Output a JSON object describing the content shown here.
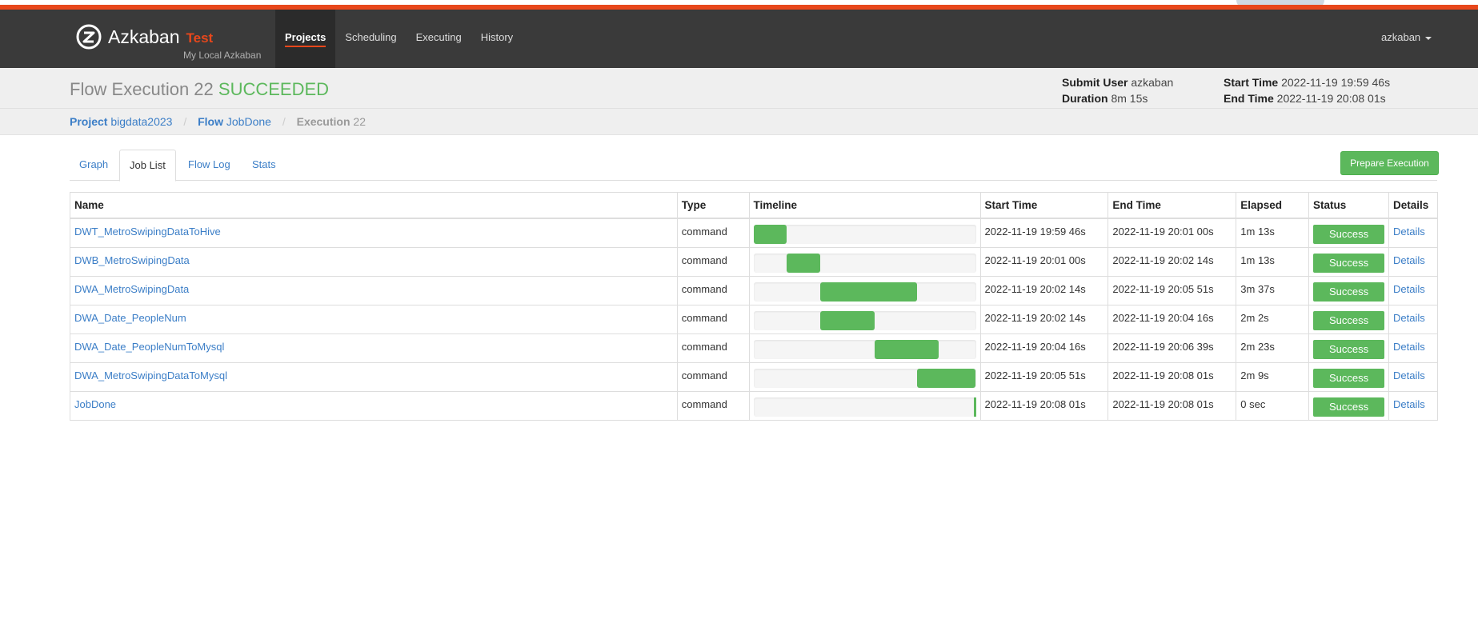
{
  "app": {
    "name": "Azkaban",
    "env": "Test",
    "subtitle": "My Local Azkaban"
  },
  "nav": {
    "items": [
      "Projects",
      "Scheduling",
      "Executing",
      "History"
    ],
    "active": "Projects",
    "user": "azkaban"
  },
  "header": {
    "title_prefix": "Flow Execution 22",
    "status": "SUCCEEDED",
    "submit_user_label": "Submit User",
    "submit_user": "azkaban",
    "duration_label": "Duration",
    "duration": "8m 15s",
    "start_time_label": "Start Time",
    "start_time": "2022-11-19 19:59 46s",
    "end_time_label": "End Time",
    "end_time": "2022-11-19 20:08 01s"
  },
  "breadcrumb": {
    "project_label": "Project",
    "project": "bigdata2023",
    "flow_label": "Flow",
    "flow": "JobDone",
    "execution_label": "Execution",
    "execution": "22"
  },
  "tabs": [
    "Graph",
    "Job List",
    "Flow Log",
    "Stats"
  ],
  "active_tab": "Job List",
  "prepare_button": "Prepare Execution",
  "table": {
    "headers": [
      "Name",
      "Type",
      "Timeline",
      "Start Time",
      "End Time",
      "Elapsed",
      "Status",
      "Details"
    ],
    "rows": [
      {
        "name": "DWT_MetroSwipingDataToHive",
        "type": "command",
        "start": "2022-11-19 19:59 46s",
        "end": "2022-11-19 20:01 00s",
        "elapsed": "1m 13s",
        "status": "Success",
        "details": "Details",
        "tl_start": 0.0,
        "tl_end": 0.149
      },
      {
        "name": "DWB_MetroSwipingData",
        "type": "command",
        "start": "2022-11-19 20:01 00s",
        "end": "2022-11-19 20:02 14s",
        "elapsed": "1m 13s",
        "status": "Success",
        "details": "Details",
        "tl_start": 0.149,
        "tl_end": 0.299
      },
      {
        "name": "DWA_MetroSwipingData",
        "type": "command",
        "start": "2022-11-19 20:02 14s",
        "end": "2022-11-19 20:05 51s",
        "elapsed": "3m 37s",
        "status": "Success",
        "details": "Details",
        "tl_start": 0.299,
        "tl_end": 0.737
      },
      {
        "name": "DWA_Date_PeopleNum",
        "type": "command",
        "start": "2022-11-19 20:02 14s",
        "end": "2022-11-19 20:04 16s",
        "elapsed": "2m 2s",
        "status": "Success",
        "details": "Details",
        "tl_start": 0.299,
        "tl_end": 0.545
      },
      {
        "name": "DWA_Date_PeopleNumToMysql",
        "type": "command",
        "start": "2022-11-19 20:04 16s",
        "end": "2022-11-19 20:06 39s",
        "elapsed": "2m 23s",
        "status": "Success",
        "details": "Details",
        "tl_start": 0.545,
        "tl_end": 0.834
      },
      {
        "name": "DWA_MetroSwipingDataToMysql",
        "type": "command",
        "start": "2022-11-19 20:05 51s",
        "end": "2022-11-19 20:08 01s",
        "elapsed": "2m 9s",
        "status": "Success",
        "details": "Details",
        "tl_start": 0.737,
        "tl_end": 1.0
      },
      {
        "name": "JobDone",
        "type": "command",
        "start": "2022-11-19 20:08 01s",
        "end": "2022-11-19 20:08 01s",
        "elapsed": "0 sec",
        "status": "Success",
        "details": "Details",
        "tl_start": 0.99,
        "tl_end": 1.0
      }
    ]
  },
  "colors": {
    "accent": "#e8471b",
    "success": "#5cb85c",
    "link": "#3b7ec7",
    "navbar": "#3a3a3a"
  }
}
